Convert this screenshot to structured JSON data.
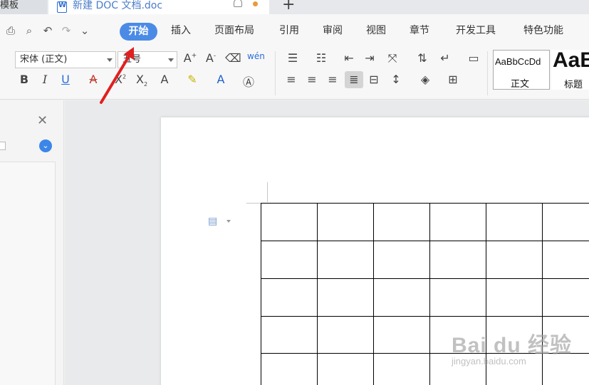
{
  "tabs": {
    "left_tab_label": "模板",
    "doc_tab_title": "新建 DOC 文档.doc",
    "new_tab_label": "+"
  },
  "quick_access": {
    "print": "⎙",
    "preview": "⌕",
    "undo": "↶",
    "redo": "↷",
    "more": "⌄"
  },
  "menu": {
    "active": "开始",
    "items": [
      "插入",
      "页面布局",
      "引用",
      "审阅",
      "视图",
      "章节",
      "开发工具",
      "特色功能"
    ]
  },
  "ribbon": {
    "font_name": "宋体 (正文)",
    "font_size": "五号",
    "styles": [
      {
        "preview": "AaBbCcDd",
        "name": "正文"
      },
      {
        "preview": "AaB",
        "name": "标题"
      }
    ]
  },
  "watermark": {
    "main": "Bai du 经验",
    "sub": "jingyan.baidu.com"
  },
  "colors": {
    "accent": "#4b8be6",
    "arrow": "#e02020"
  }
}
